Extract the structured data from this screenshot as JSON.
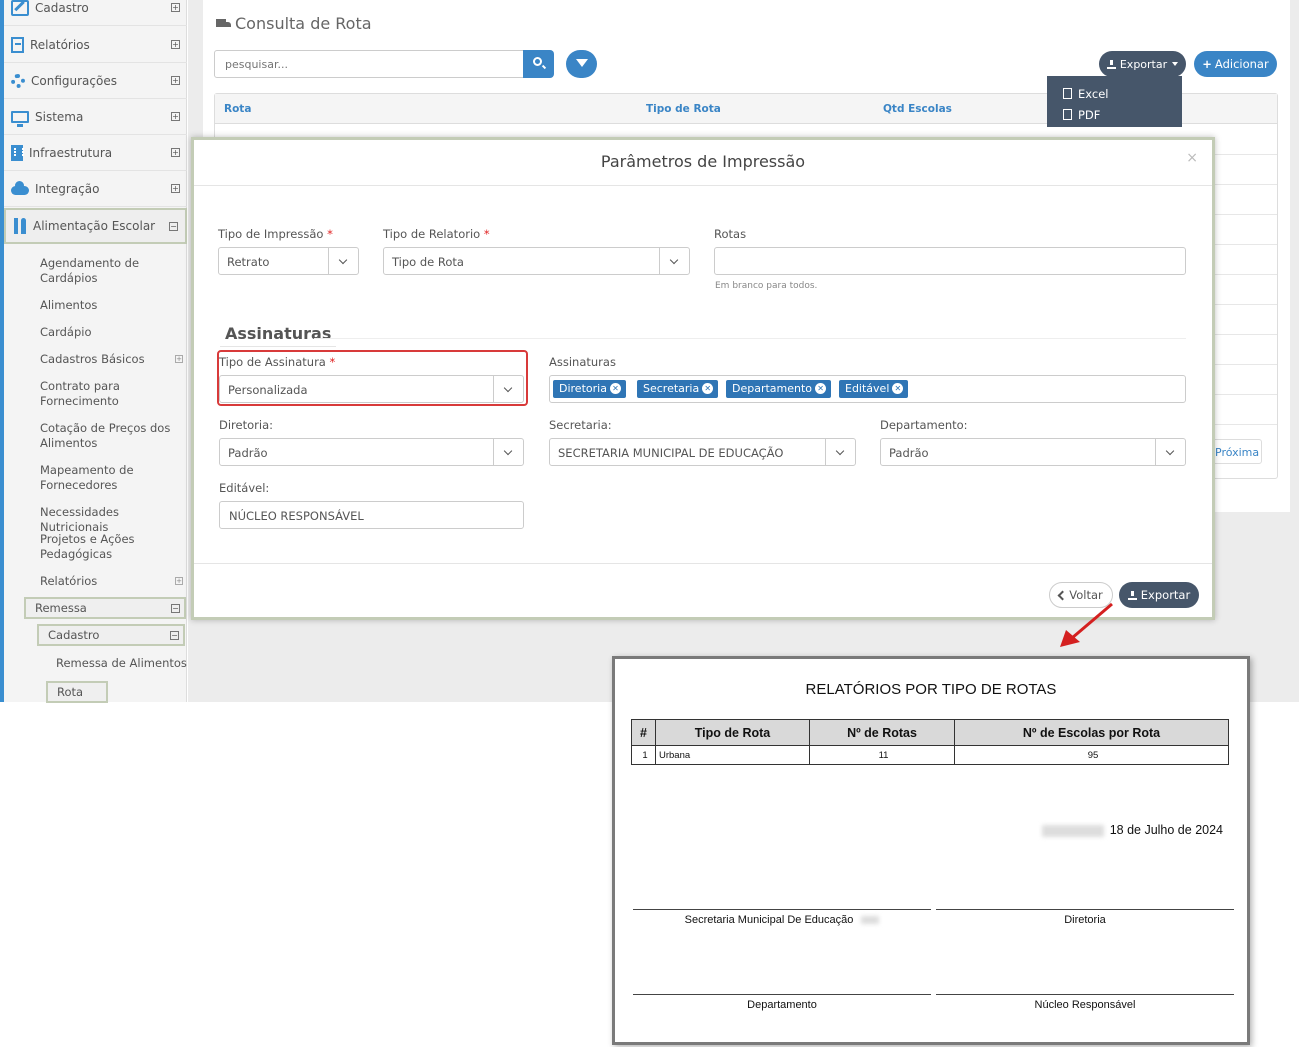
{
  "sidebar": {
    "items": [
      {
        "label": "Cadastro",
        "icon": "pencil-square-icon"
      },
      {
        "label": "Relatórios",
        "icon": "document-icon"
      },
      {
        "label": "Configurações",
        "icon": "gear-icon"
      },
      {
        "label": "Sistema",
        "icon": "monitor-icon"
      },
      {
        "label": "Infraestrutura",
        "icon": "building-icon"
      },
      {
        "label": "Integração",
        "icon": "cloud-icon"
      },
      {
        "label": "Alimentação Escolar",
        "icon": "utensils-icon"
      }
    ],
    "sub_items": [
      "Agendamento de Cardápios",
      "Alimentos",
      "Cardápio",
      "Cadastros Básicos",
      "Contrato para Fornecimento",
      "Cotação de Preços dos Alimentos",
      "Mapeamento de Fornecedores",
      "Necessidades Nutricionais",
      "Projetos e Ações Pedagógicas",
      "Relatórios"
    ],
    "remessa": "Remessa",
    "cadastro": "Cadastro",
    "remessa_alimentos": "Remessa de Alimentos",
    "rota": "Rota",
    "accent_color": "#3a8ed0"
  },
  "page": {
    "title": "Consulta de Rota",
    "search_placeholder": "pesquisar...",
    "export_label": "Exportar",
    "add_label": "Adicionar",
    "export_menu": [
      "Excel",
      "PDF"
    ],
    "columns": [
      "Rota",
      "Tipo de Rota",
      "Qtd Escolas"
    ],
    "next_label": "Próxima"
  },
  "modal": {
    "title": "Parâmetros de Impressão",
    "close": "×",
    "tipo_impressao_label": "Tipo de Impressão",
    "tipo_impressao_value": "Retrato",
    "tipo_relatorio_label": "Tipo de Relatorio",
    "tipo_relatorio_value": "Tipo de Rota",
    "rotas_label": "Rotas",
    "rotas_help": "Em branco para todos.",
    "section": "Assinaturas",
    "tipo_assinatura_label": "Tipo de Assinatura",
    "tipo_assinatura_value": "Personalizada",
    "assinaturas_label": "Assinaturas",
    "tags": [
      "Diretoria",
      "Secretaria",
      "Departamento",
      "Editável"
    ],
    "diretoria_label": "Diretoria:",
    "diretoria_value": "Padrão",
    "secretaria_label": "Secretaria:",
    "secretaria_value": "SECRETARIA MUNICIPAL DE EDUCAÇÃO",
    "departamento_label": "Departamento:",
    "departamento_value": "Padrão",
    "editavel_label": "Editável:",
    "editavel_value": "NÚCLEO RESPONSÁVEL",
    "back_label": "Voltar",
    "export_label": "Exportar",
    "required_mark": "*"
  },
  "report": {
    "title": "RELATÓRIOS POR TIPO DE ROTAS",
    "headers": [
      "#",
      "Tipo de Rota",
      "Nº de Rotas",
      "Nº de Escolas por Rota"
    ],
    "rows": [
      [
        "1",
        "Urbana",
        "11",
        "95"
      ]
    ],
    "date": "18 de Julho de 2024",
    "signatures": [
      "Secretaria Municipal De Educação",
      "Diretoria",
      "Departamento",
      "Núcleo Responsável"
    ]
  }
}
